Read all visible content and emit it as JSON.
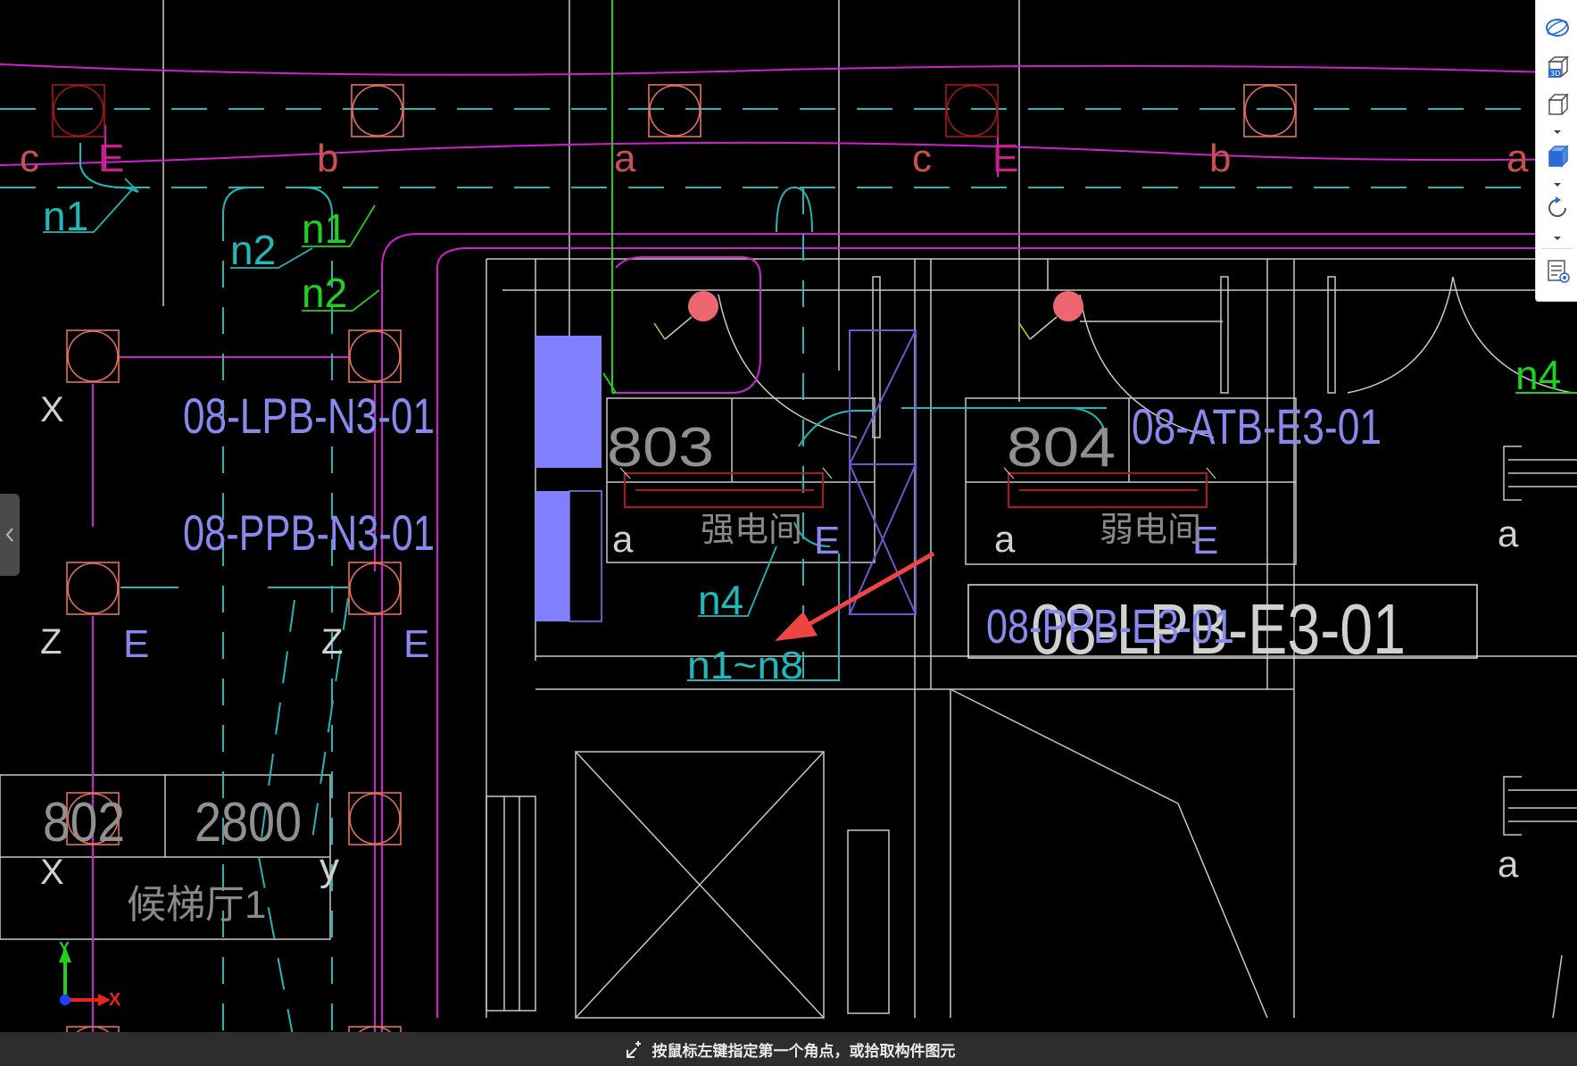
{
  "canvas": {
    "grid_letters": [
      "c",
      "E",
      "b",
      "a",
      "c",
      "E",
      "b",
      "a",
      "X",
      "Z",
      "E",
      "Z",
      "E",
      "X",
      "y",
      "a",
      "E",
      "a",
      "E",
      "a",
      "a"
    ],
    "room_803": "803",
    "room_804": "804",
    "room_802": "802",
    "dimension_2800": "2800",
    "strong_room": "强电间",
    "weak_room": "弱电间",
    "elevator_hall": "候梯厅1",
    "tag_lpb_n3": "08-LPB-N3-01",
    "tag_ppb_n3": "08-PPB-N3-01",
    "tag_atb_e3": "08-ATB-E3-01",
    "tag_lpb_e3_big": "08-LPB-E3-01",
    "tag_ppb_e3_small": "08-PPB-E3-01",
    "circuit_n1": "n1",
    "circuit_n2": "n2",
    "circuit_n4": "n4",
    "circuit_range": "n1~n8",
    "axis_x": "X",
    "axis_y": "Y"
  },
  "statusbar": {
    "message": "按鼠标左键指定第一个角点，或拾取构件图元"
  },
  "toolbar": {
    "buttons": [
      "orbit-icon",
      "3d-view-icon",
      "cube-view-icon",
      "shaded-cube-icon",
      "rotate-icon",
      "layer-display-icon"
    ]
  },
  "colors": {
    "background": "#000000",
    "wall": "#c8c8c8",
    "magenta_wire": "#d020d0",
    "cyan": "#20b8b8",
    "green": "#20d020",
    "column": "#e07060",
    "tag_blue": "#8888ee",
    "panel_fill": "#8080ff",
    "arrow": "#ee4444"
  }
}
